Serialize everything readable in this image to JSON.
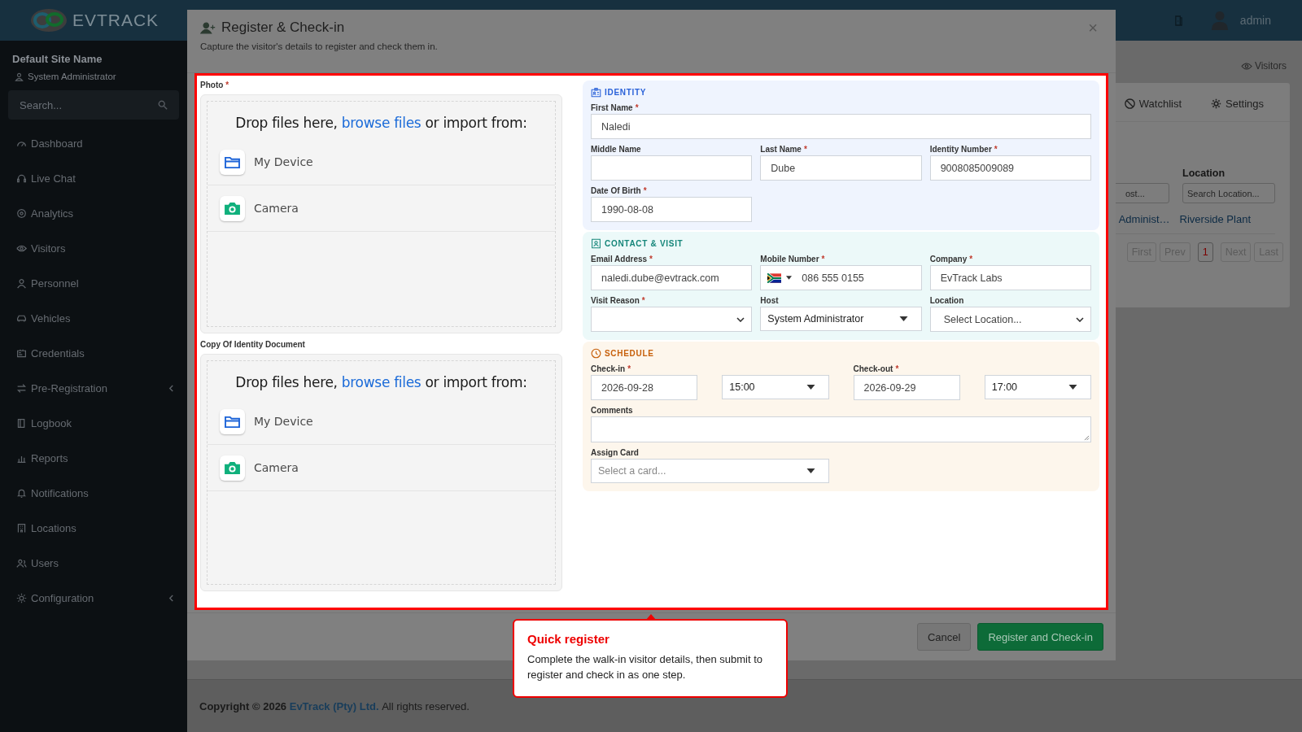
{
  "brand": {
    "logo": "**EV**TRACK"
  },
  "topbar": {
    "user": "admin"
  },
  "sidebar": {
    "site": "Default Site Name",
    "role": "System Administrator",
    "search": {
      "placeholder": "Search..."
    },
    "items": [
      {
        "label": "Dashboard",
        "expandable": false
      },
      {
        "label": "Live Chat",
        "expandable": false
      },
      {
        "label": "Analytics",
        "expandable": false
      },
      {
        "label": "Visitors",
        "expandable": false
      },
      {
        "label": "Personnel",
        "expandable": false
      },
      {
        "label": "Vehicles",
        "expandable": false
      },
      {
        "label": "Credentials",
        "expandable": false
      },
      {
        "label": "Pre-Registration",
        "expandable": true
      },
      {
        "label": "Logbook",
        "expandable": false
      },
      {
        "label": "Reports",
        "expandable": false
      },
      {
        "label": "Notifications",
        "expandable": false
      },
      {
        "label": "Locations",
        "expandable": false
      },
      {
        "label": "Users",
        "expandable": false
      },
      {
        "label": "Configuration",
        "expandable": true
      }
    ]
  },
  "page": {
    "breadcrumb": "Visitors",
    "tabs": [
      {
        "label": "Watchlist"
      },
      {
        "label": "Settings"
      }
    ],
    "filter": {
      "label": "Location",
      "host_value": "ost...",
      "placeholder": "Search Location..."
    },
    "row": [
      "Administ…",
      "Riverside Plant"
    ],
    "pagination": [
      {
        "label": "First",
        "selected": false
      },
      {
        "label": "Prev",
        "selected": false
      },
      {
        "label": "1",
        "selected": true
      },
      {
        "label": "Next",
        "selected": false
      },
      {
        "label": "Last",
        "selected": false
      }
    ]
  },
  "modal": {
    "title": "Register & Check-in",
    "subtitle": "Capture the visitor's details to register and check them in.",
    "close": "×",
    "uploads": [
      {
        "label": "Photo",
        "mark": "*",
        "prompt": {
          "before": "Drop files here,",
          "link": "browse files",
          "after": "or import from:"
        },
        "sources": [
          "My Device",
          "Camera"
        ]
      },
      {
        "label": "Copy Of Identity Document",
        "prompt": {
          "before": "Drop files here,",
          "link": "browse files",
          "after": "or import from:"
        },
        "sources": [
          "My Device",
          "Camera"
        ]
      }
    ],
    "sections": [
      {
        "kind": "identity",
        "title": "IDENTITY",
        "rows": [
          [
            {
              "kind": "text",
              "label": "First Name",
              "mark": "*",
              "value": "Naledi"
            }
          ],
          [
            {
              "kind": "text",
              "label": "Middle Name"
            },
            {
              "kind": "text",
              "label": "Last Name",
              "mark": "*",
              "value": "Dube"
            },
            {
              "kind": "text",
              "label": "Identity Number",
              "mark": "*",
              "value": "9008085009089"
            }
          ],
          [
            {
              "kind": "text",
              "label": "Date Of Birth",
              "mark": "*",
              "value": "1990-08-08"
            }
          ]
        ]
      },
      {
        "kind": "contact",
        "title": "CONTACT & VISIT",
        "rows": [
          [
            {
              "kind": "text",
              "label": "Email Address",
              "mark": "*",
              "value": "naledi.dube@evtrack.com"
            },
            {
              "kind": "phone",
              "label": "Mobile Number",
              "mark": "*",
              "value": "086 555 0155"
            },
            {
              "kind": "text",
              "label": "Company",
              "mark": "*",
              "value": "EvTrack Labs"
            }
          ],
          [
            {
              "kind": "select",
              "label": "Visit Reason",
              "mark": "*"
            },
            {
              "kind": "combo",
              "label": "Host",
              "value": "System Administrator"
            },
            {
              "kind": "select",
              "label": "Location",
              "value": "Select Location..."
            }
          ]
        ]
      },
      {
        "kind": "schedule",
        "title": "SCHEDULE",
        "rows": [
          [
            {
              "kind": "text",
              "label": "Check-in",
              "mark": "*",
              "value": "2026-09-28"
            },
            {
              "kind": "combo",
              "value": "15:00"
            },
            {
              "kind": "text",
              "label": "Check-out",
              "mark": "*",
              "value": "2026-09-29"
            },
            {
              "kind": "combo",
              "value": "17:00"
            }
          ],
          [
            {
              "kind": "textarea",
              "label": "Comments"
            }
          ],
          [
            {
              "kind": "combo",
              "label": "Assign Card",
              "placeholder": "Select a card..."
            }
          ]
        ]
      }
    ],
    "buttons": [
      {
        "kind": "secondary",
        "label": "Cancel"
      },
      {
        "kind": "primary",
        "label": "Register and Check-in"
      }
    ]
  },
  "tour": {
    "title": "Quick register",
    "text": "Complete the walk-in visitor details, then submit to register and check in as one step."
  },
  "footer": {
    "before": "Copyright © 2026",
    "link": "EvTrack (Pty) Ltd.",
    "after": "All rights reserved."
  }
}
